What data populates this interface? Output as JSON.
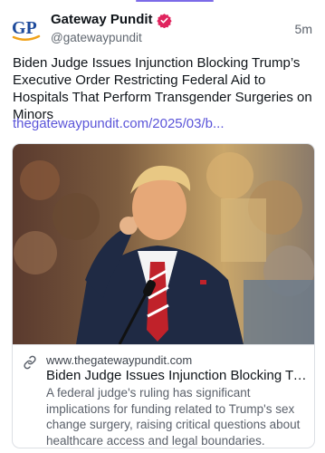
{
  "post": {
    "author": {
      "display_name": "Gateway Pundit",
      "handle": "@gatewaypundit",
      "avatar_text": "GP",
      "verified_icon": "verified-badge-icon",
      "verified_color": "#e0245e"
    },
    "timestamp": "5m",
    "text": "Biden Judge Issues Injunction Blocking Trump’s Executive Order Restricting Federal Aid to Hospitals That Perform Transgender Surgeries on Minors",
    "link": "thegatewaypundit.com/2025/03/b...",
    "card": {
      "domain": "www.thegatewaypundit.com",
      "title": "Biden Judge Issues Injunction Blocking Trump'...",
      "description": "A federal judge's ruling has significant implications for funding related to Trump's sex change surgery, raising critical questions about healthcare access and legal boundaries. Insights into the case reveal deeper politi...",
      "link_icon": "link-icon"
    }
  },
  "colors": {
    "accent": "#7c6be8",
    "link": "#5b55d9",
    "avatar_blue": "#1e4b9c",
    "avatar_orange": "#f0a21a"
  }
}
